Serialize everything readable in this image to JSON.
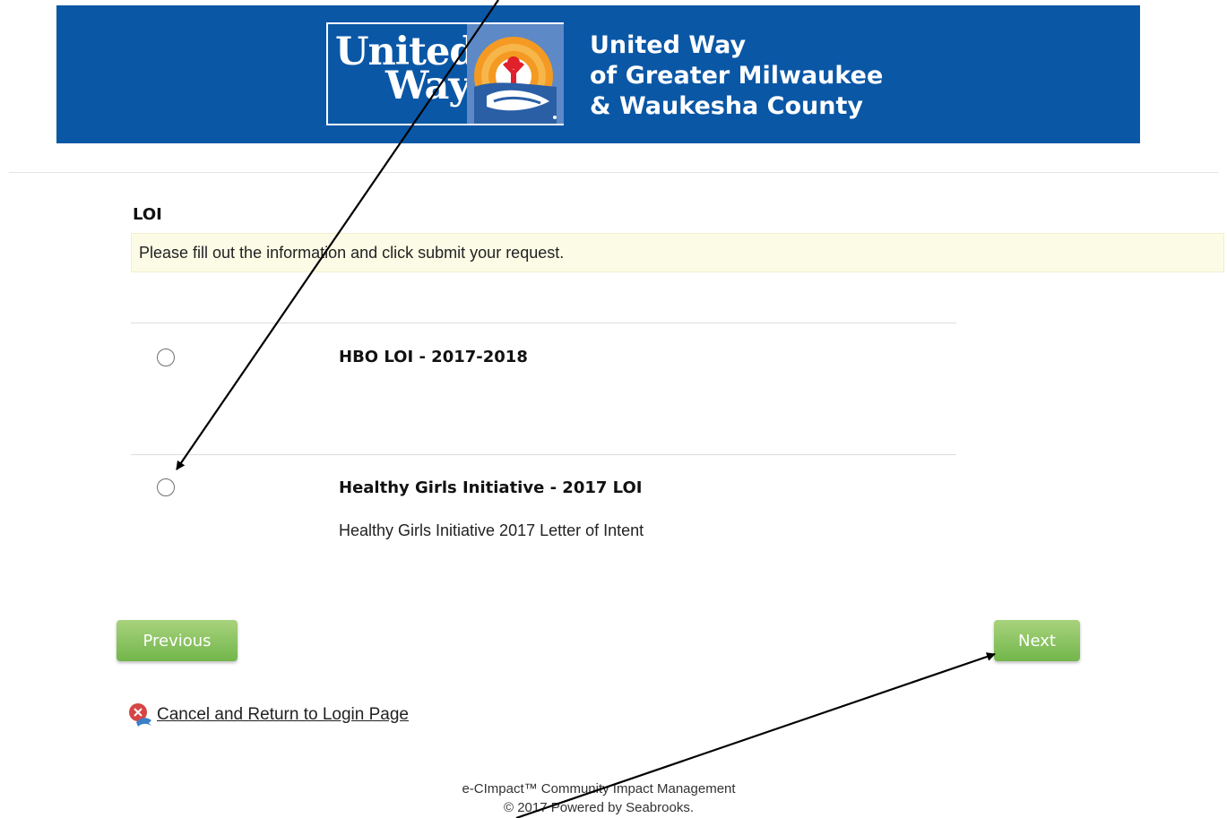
{
  "banner": {
    "logo_word_1": "United",
    "logo_word_2": "Way",
    "org_line_1": "United Way",
    "org_line_2": "of Greater Milwaukee",
    "org_line_3": "& Waukesha County",
    "colors": {
      "brand_blue": "#0a57a6",
      "emblem_blue": "#5d89c6",
      "emblem_orange": "#f49a22",
      "emblem_red": "#e0202a"
    }
  },
  "form": {
    "title": "LOI",
    "notice": "Please fill out the information and click submit your request.",
    "options": [
      {
        "title": "HBO LOI - 2017-2018",
        "description": "",
        "selected": false
      },
      {
        "title": "Healthy Girls Initiative - 2017 LOI",
        "description": "Healthy Girls Initiative 2017 Letter of Intent",
        "selected": false
      }
    ]
  },
  "nav": {
    "previous_label": "Previous",
    "next_label": "Next",
    "cancel_label": "Cancel and Return to Login Page",
    "button_color": "#7dbb55"
  },
  "footer": {
    "line_1": "e-CImpact™ Community Impact Management",
    "line_2": "© 2017 Powered by Seabrooks."
  },
  "annotations": {
    "arrow_color": "#000000",
    "arrows": [
      "arrow-to-healthy-girls-radio",
      "arrow-to-next-button"
    ]
  }
}
